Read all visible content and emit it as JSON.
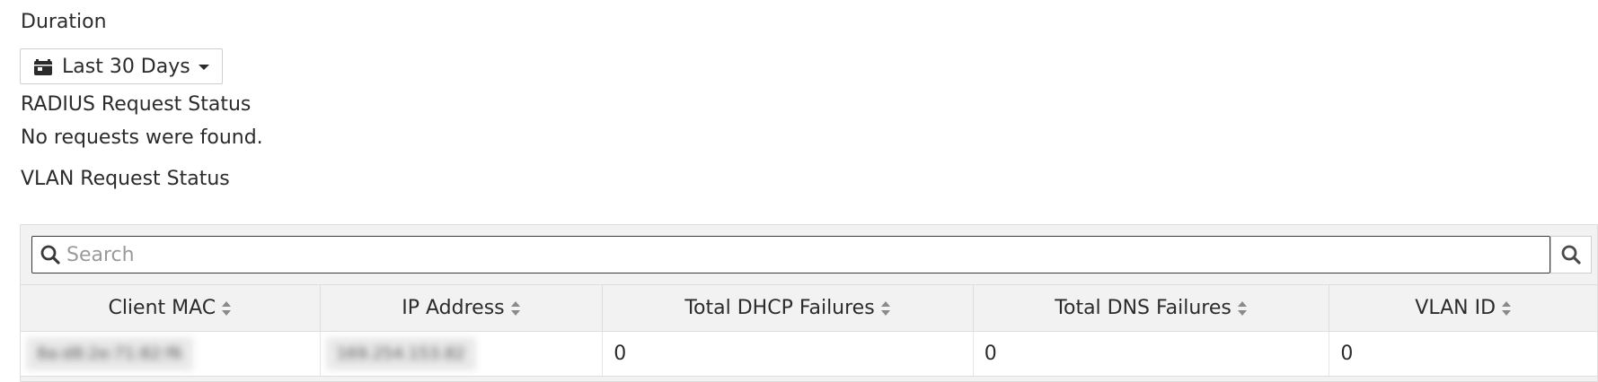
{
  "duration": {
    "label": "Duration",
    "selected": "Last 30 Days",
    "icon": "calendar-icon"
  },
  "radius": {
    "title": "RADIUS Request Status",
    "empty_message": "No requests were found."
  },
  "vlan": {
    "title": "VLAN Request Status",
    "search": {
      "placeholder": "Search",
      "value": ""
    },
    "columns": [
      "Client MAC",
      "IP Address",
      "Total DHCP Failures",
      "Total DNS Failures",
      "VLAN ID"
    ],
    "rows": [
      {
        "client_mac": "8a:d8:2e:71:82:f6",
        "ip_address": "169.254.153.82",
        "dhcp_failures": "0",
        "dns_failures": "0",
        "vlan_id": "0"
      }
    ]
  },
  "colors": {
    "panel_bg": "#f2f2f2",
    "border": "#dedede",
    "text": "#2b2b2b"
  }
}
